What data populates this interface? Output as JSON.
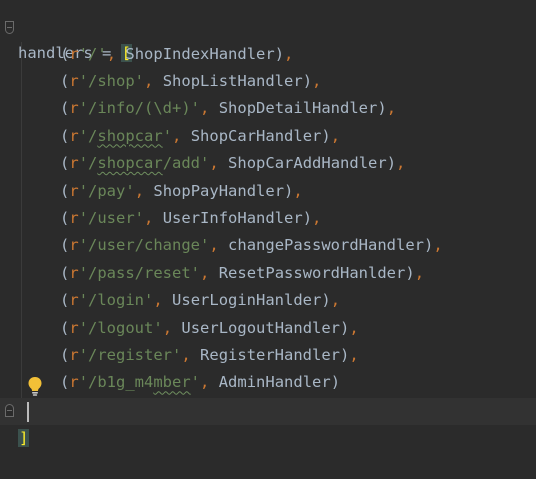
{
  "editor": {
    "first_line": {
      "identifier": "handlers",
      "assign": " = ",
      "open_bracket": "["
    },
    "routes": [
      {
        "prefix": "r",
        "path": "'/'",
        "path_squiggle": "",
        "path_rest": "",
        "handler": "ShopIndexHandler"
      },
      {
        "prefix": "r",
        "path": "'/shop'",
        "path_squiggle": "",
        "path_rest": "",
        "handler": "ShopListHandler"
      },
      {
        "prefix": "r",
        "path": "'/info/(\\d+)'",
        "path_squiggle": "",
        "path_rest": "",
        "handler": "ShopDetailHandler"
      },
      {
        "prefix": "r",
        "path": "'/",
        "path_squiggle": "shopcar",
        "path_rest": "'",
        "handler": "ShopCarHandler"
      },
      {
        "prefix": "r",
        "path": "'/",
        "path_squiggle": "shopcar",
        "path_rest": "/add'",
        "handler": "ShopCarAddHandler"
      },
      {
        "prefix": "r",
        "path": "'/pay'",
        "path_squiggle": "",
        "path_rest": "",
        "handler": "ShopPayHandler"
      },
      {
        "prefix": "r",
        "path": "'/user'",
        "path_squiggle": "",
        "path_rest": "",
        "handler": "UserInfoHandler"
      },
      {
        "prefix": "r",
        "path": "'/user/change'",
        "path_squiggle": "",
        "path_rest": "",
        "handler": "changePasswordHandler"
      },
      {
        "prefix": "r",
        "path": "'/pass/reset'",
        "path_squiggle": "",
        "path_rest": "",
        "handler": "ResetPasswordHanlder"
      },
      {
        "prefix": "r",
        "path": "'/login'",
        "path_squiggle": "",
        "path_rest": "",
        "handler": "UserLoginHanlder"
      },
      {
        "prefix": "r",
        "path": "'/logout'",
        "path_squiggle": "",
        "path_rest": "",
        "handler": "UserLogoutHandler"
      },
      {
        "prefix": "r",
        "path": "'/register'",
        "path_squiggle": "",
        "path_rest": "",
        "handler": "RegisterHandler"
      },
      {
        "prefix": "r",
        "path": "'/b1g_m4",
        "path_squiggle": "mber",
        "path_rest": "'",
        "handler": "AdminHandler"
      }
    ],
    "last_line": {
      "close_bracket": "]"
    },
    "open_paren": "(",
    "close_paren": ")",
    "comma": ",",
    "separator": " ",
    "intention_icon": "lightbulb-icon",
    "colors": {
      "background": "#2b2b2b",
      "current_line": "#323232",
      "identifier": "#a9b7c6",
      "keyword": "#cc7832",
      "string": "#6a8759",
      "bracket_match": "#ffef28",
      "bulb": "#f2c037"
    }
  }
}
